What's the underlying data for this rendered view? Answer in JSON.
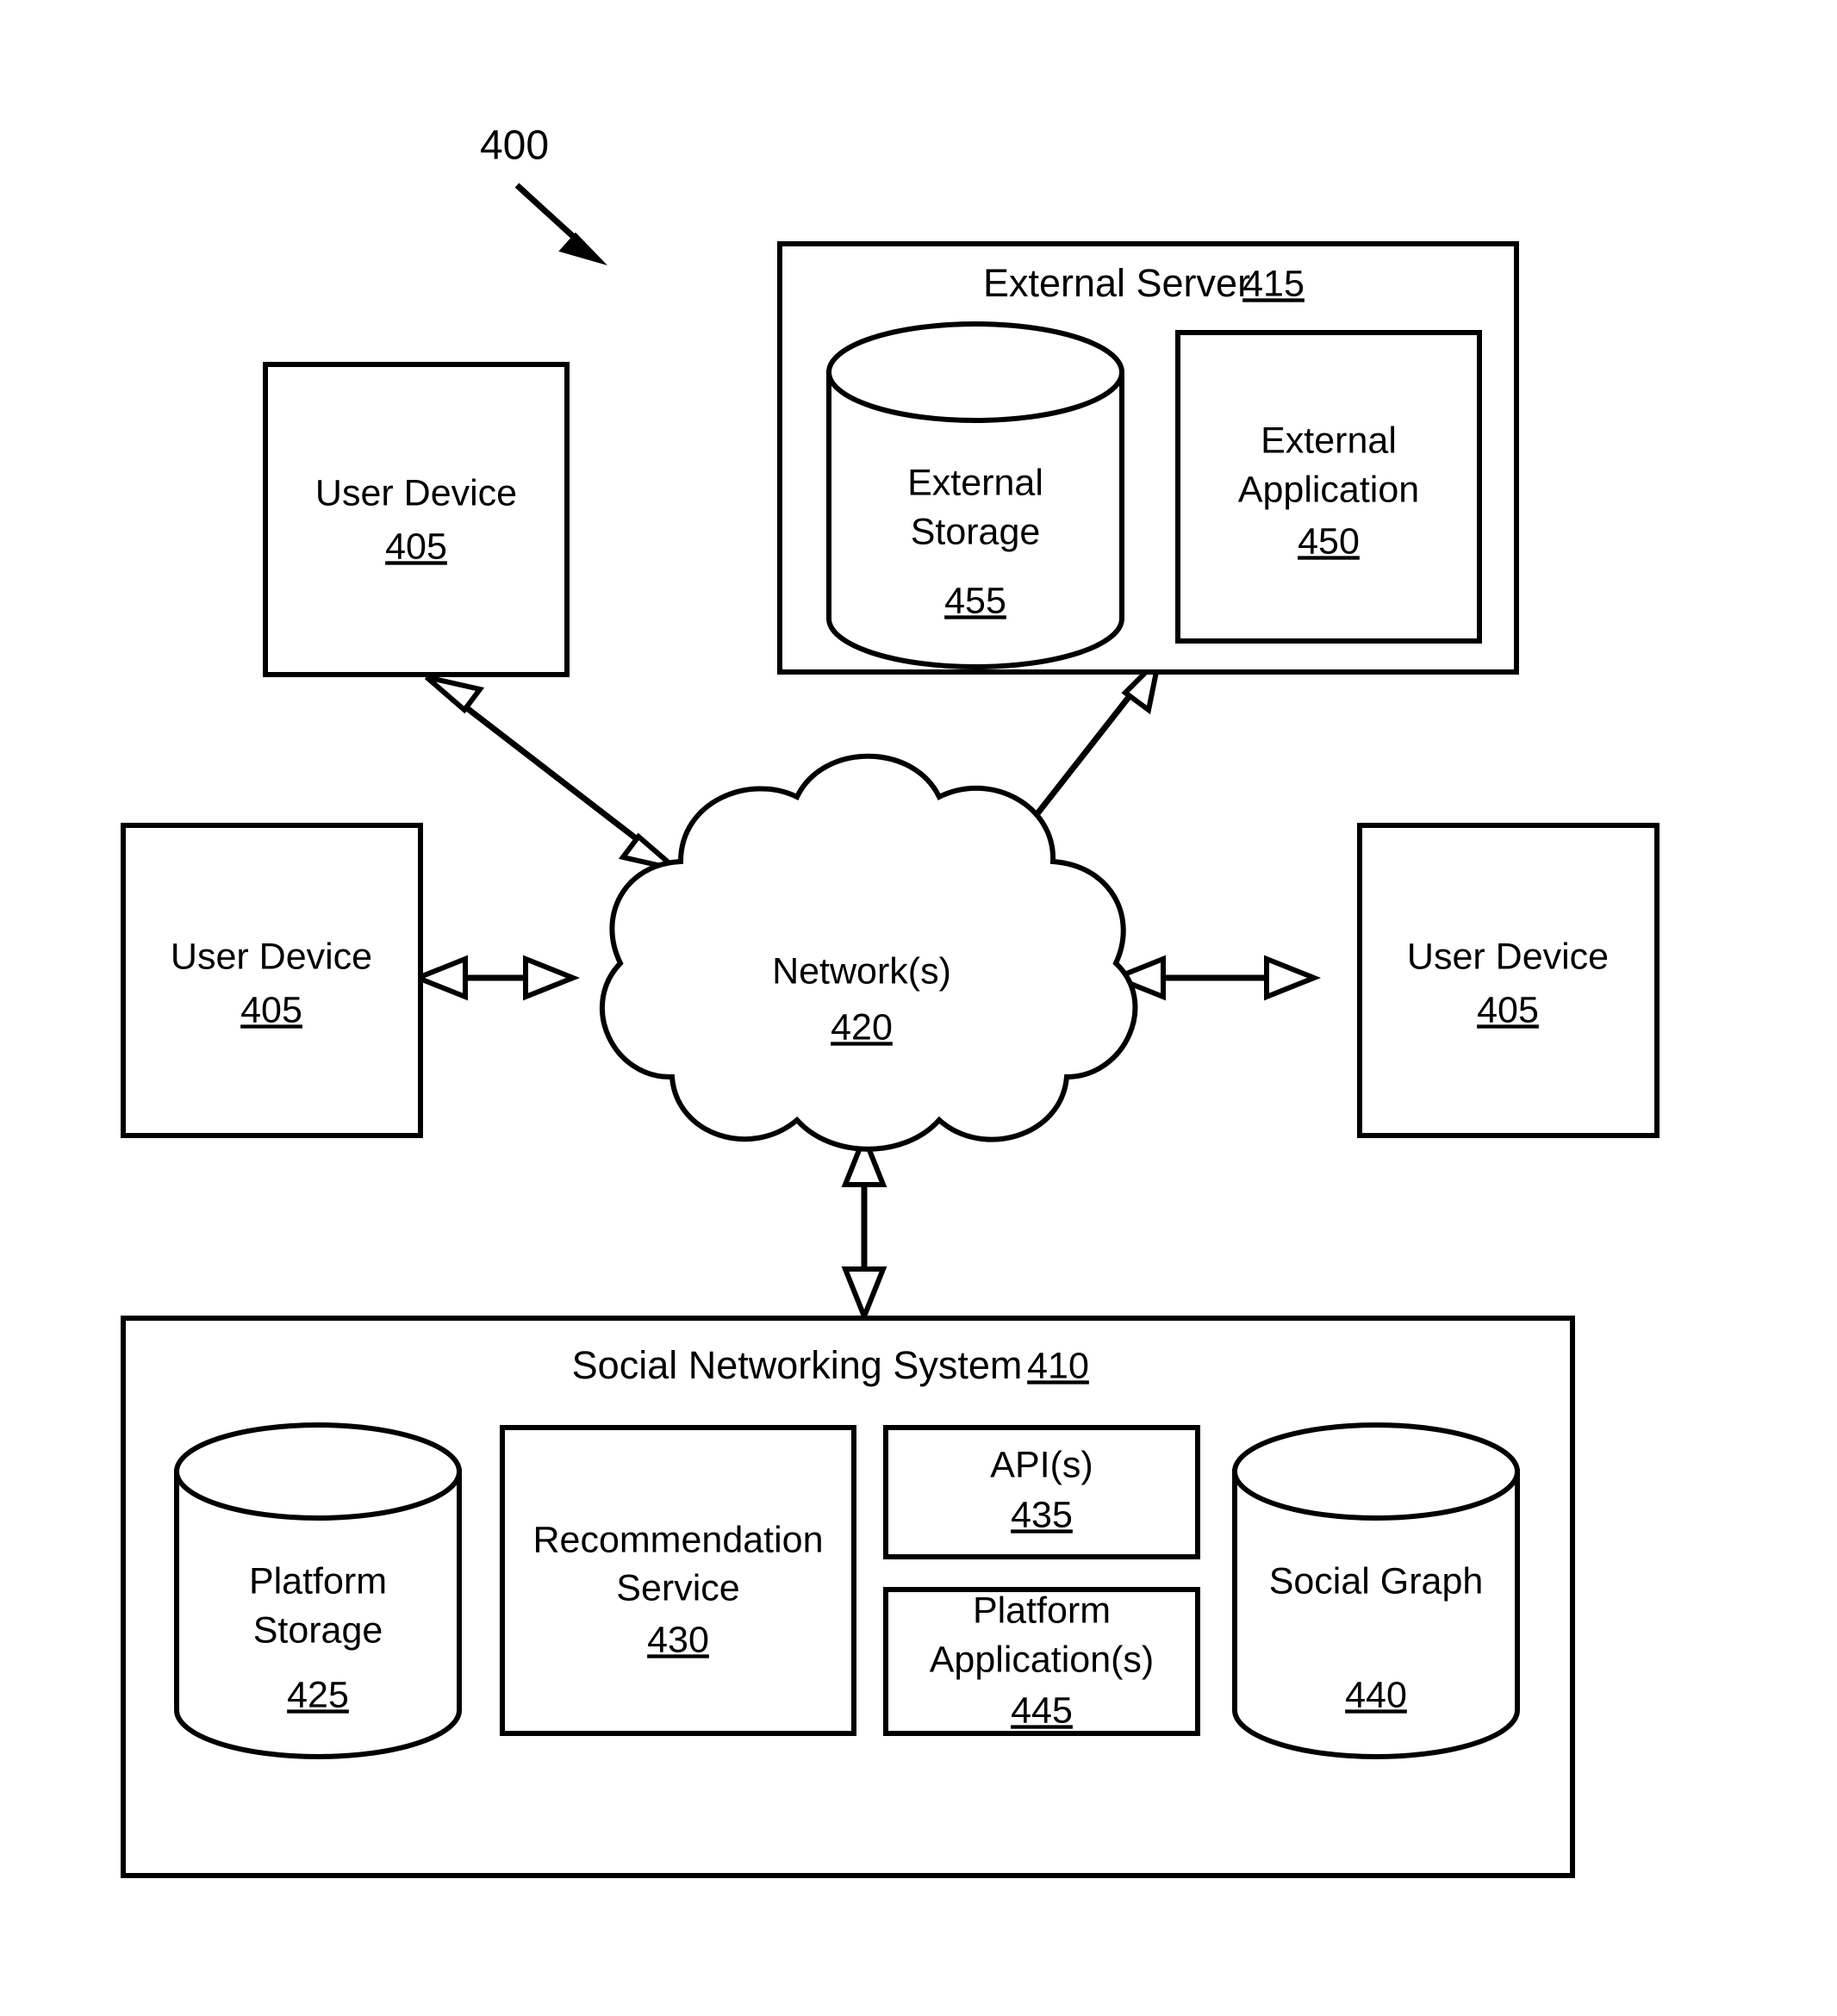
{
  "figure": {
    "number": "400",
    "pointer_icon": "diagonal-arrow-icon"
  },
  "nodes": {
    "user_device_top": {
      "label": "User Device",
      "ref": "405"
    },
    "user_device_left": {
      "label": "User Device",
      "ref": "405"
    },
    "user_device_right": {
      "label": "User Device",
      "ref": "405"
    },
    "network": {
      "label": "Network(s)",
      "ref": "420",
      "shape": "cloud-icon"
    },
    "external_server": {
      "label": "External Server",
      "ref": "415",
      "children": {
        "external_storage": {
          "line1": "External",
          "line2": "Storage",
          "ref": "455",
          "shape": "cylinder-icon"
        },
        "external_application": {
          "line1": "External",
          "line2": "Application",
          "ref": "450",
          "shape": "box-icon"
        }
      }
    },
    "social_networking_system": {
      "label": "Social Networking System",
      "ref": "410",
      "children": {
        "platform_storage": {
          "line1": "Platform",
          "line2": "Storage",
          "ref": "425",
          "shape": "cylinder-icon"
        },
        "recommendation_service": {
          "line1": "Recommendation",
          "line2": "Service",
          "ref": "430",
          "shape": "box-icon"
        },
        "apis": {
          "line1": "API(s)",
          "ref": "435",
          "shape": "box-icon"
        },
        "platform_applications": {
          "line1": "Platform",
          "line2": "Application(s)",
          "ref": "445",
          "shape": "box-icon"
        },
        "social_graph": {
          "line1": "Social Graph",
          "ref": "440",
          "shape": "cylinder-icon"
        }
      }
    }
  },
  "connectors": [
    {
      "name": "user-device-top-to-network",
      "from": "user_device_top",
      "to": "network",
      "style": "double-headed-hollow-arrow"
    },
    {
      "name": "external-server-to-network",
      "from": "external_server",
      "to": "network",
      "style": "double-headed-hollow-arrow"
    },
    {
      "name": "user-device-left-to-network",
      "from": "user_device_left",
      "to": "network",
      "style": "double-headed-hollow-arrow"
    },
    {
      "name": "user-device-right-to-network",
      "from": "user_device_right",
      "to": "network",
      "style": "double-headed-hollow-arrow"
    },
    {
      "name": "network-to-social-networking-system",
      "from": "network",
      "to": "social_networking_system",
      "style": "double-headed-hollow-arrow"
    }
  ],
  "colors": {
    "stroke": "#000000",
    "fill": "#ffffff"
  }
}
